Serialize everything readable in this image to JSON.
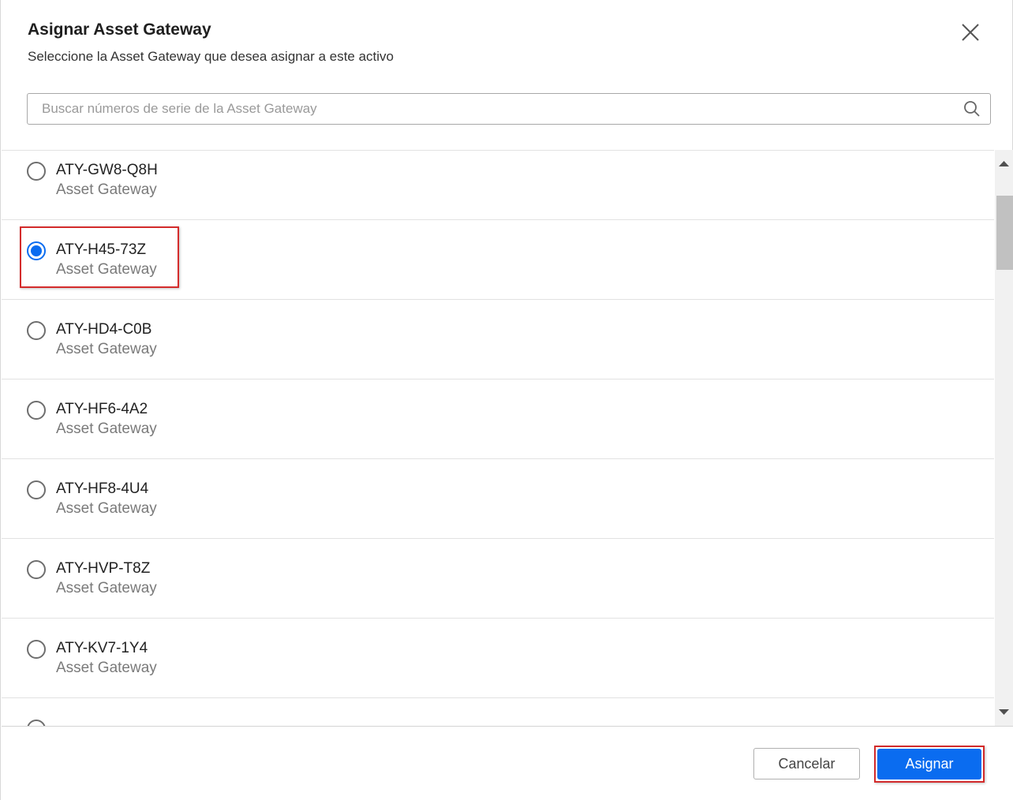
{
  "dialog": {
    "title": "Asignar Asset Gateway",
    "subtitle": "Seleccione la Asset Gateway que desea asignar a este activo",
    "close_icon": "close-icon"
  },
  "search": {
    "placeholder": "Buscar números de serie de la Asset Gateway",
    "value": "",
    "icon": "search-icon"
  },
  "list": {
    "items": [
      {
        "serial": "ATY-GW8-Q8H",
        "type": "Asset Gateway",
        "selected": false
      },
      {
        "serial": "ATY-H45-73Z",
        "type": "Asset Gateway",
        "selected": true
      },
      {
        "serial": "ATY-HD4-C0B",
        "type": "Asset Gateway",
        "selected": false
      },
      {
        "serial": "ATY-HF6-4A2",
        "type": "Asset Gateway",
        "selected": false
      },
      {
        "serial": "ATY-HF8-4U4",
        "type": "Asset Gateway",
        "selected": false
      },
      {
        "serial": "ATY-HVP-T8Z",
        "type": "Asset Gateway",
        "selected": false
      },
      {
        "serial": "ATY-KV7-1Y4",
        "type": "Asset Gateway",
        "selected": false
      },
      {
        "serial": "",
        "type": "",
        "selected": false
      }
    ]
  },
  "footer": {
    "cancel_label": "Cancelar",
    "assign_label": "Asignar"
  },
  "colors": {
    "accent": "#0a6cf0",
    "highlight": "#d42b2b"
  }
}
